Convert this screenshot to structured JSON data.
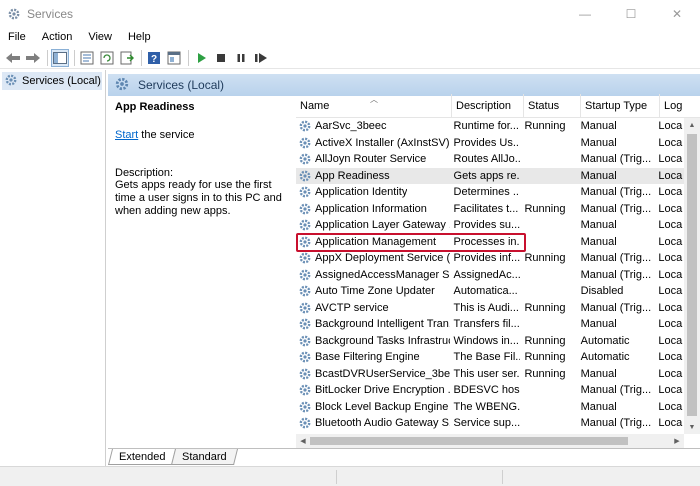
{
  "window": {
    "title": "Services",
    "minimize": "—",
    "maximize": "☐",
    "close": "✕"
  },
  "menu": [
    "File",
    "Action",
    "View",
    "Help"
  ],
  "tree": {
    "root_label": "Services (Local)"
  },
  "pane": {
    "header": "Services (Local)",
    "selected_service": "App Readiness",
    "start_link": "Start",
    "start_rest": " the service",
    "description_label": "Description:",
    "description_text": "Gets apps ready for use the first time a user signs in to this PC and when adding new apps."
  },
  "table": {
    "columns": [
      "Name",
      "Description",
      "Status",
      "Startup Type",
      "Log"
    ],
    "rows": [
      {
        "name": "AarSvc_3beec",
        "desc": "Runtime for...",
        "status": "Running",
        "type": "Manual",
        "log": "Loca"
      },
      {
        "name": "ActiveX Installer (AxInstSV)",
        "desc": "Provides Us...",
        "status": "",
        "type": "Manual",
        "log": "Loca"
      },
      {
        "name": "AllJoyn Router Service",
        "desc": "Routes AllJo...",
        "status": "",
        "type": "Manual (Trig...",
        "log": "Loca"
      },
      {
        "name": "App Readiness",
        "desc": "Gets apps re...",
        "status": "",
        "type": "Manual",
        "log": "Loca"
      },
      {
        "name": "Application Identity",
        "desc": "Determines ...",
        "status": "",
        "type": "Manual (Trig...",
        "log": "Loca"
      },
      {
        "name": "Application Information",
        "desc": "Facilitates t...",
        "status": "Running",
        "type": "Manual (Trig...",
        "log": "Loca"
      },
      {
        "name": "Application Layer Gateway ...",
        "desc": "Provides su...",
        "status": "",
        "type": "Manual",
        "log": "Loca"
      },
      {
        "name": "Application Management",
        "desc": "Processes in...",
        "status": "",
        "type": "Manual",
        "log": "Loca"
      },
      {
        "name": "AppX Deployment Service (...",
        "desc": "Provides inf...",
        "status": "Running",
        "type": "Manual (Trig...",
        "log": "Loca"
      },
      {
        "name": "AssignedAccessManager Se...",
        "desc": "AssignedAc...",
        "status": "",
        "type": "Manual (Trig...",
        "log": "Loca"
      },
      {
        "name": "Auto Time Zone Updater",
        "desc": "Automatica...",
        "status": "",
        "type": "Disabled",
        "log": "Loca"
      },
      {
        "name": "AVCTP service",
        "desc": "This is Audi...",
        "status": "Running",
        "type": "Manual (Trig...",
        "log": "Loca"
      },
      {
        "name": "Background Intelligent Tran...",
        "desc": "Transfers fil...",
        "status": "",
        "type": "Manual",
        "log": "Loca"
      },
      {
        "name": "Background Tasks Infrastruc...",
        "desc": "Windows in...",
        "status": "Running",
        "type": "Automatic",
        "log": "Loca"
      },
      {
        "name": "Base Filtering Engine",
        "desc": "The Base Fil...",
        "status": "Running",
        "type": "Automatic",
        "log": "Loca"
      },
      {
        "name": "BcastDVRUserService_3beec",
        "desc": "This user ser...",
        "status": "Running",
        "type": "Manual",
        "log": "Loca"
      },
      {
        "name": "BitLocker Drive Encryption ...",
        "desc": "BDESVC hos...",
        "status": "",
        "type": "Manual (Trig...",
        "log": "Loca"
      },
      {
        "name": "Block Level Backup Engine ...",
        "desc": "The WBENG...",
        "status": "",
        "type": "Manual",
        "log": "Loca"
      },
      {
        "name": "Bluetooth Audio Gateway S...",
        "desc": "Service sup...",
        "status": "",
        "type": "Manual (Trig...",
        "log": "Loca"
      }
    ]
  },
  "tabs": [
    "Extended",
    "Standard"
  ],
  "colors": {
    "accent": "#c8102e",
    "header_bg": "#c4d9ee",
    "gear": "#6a8fb5"
  }
}
